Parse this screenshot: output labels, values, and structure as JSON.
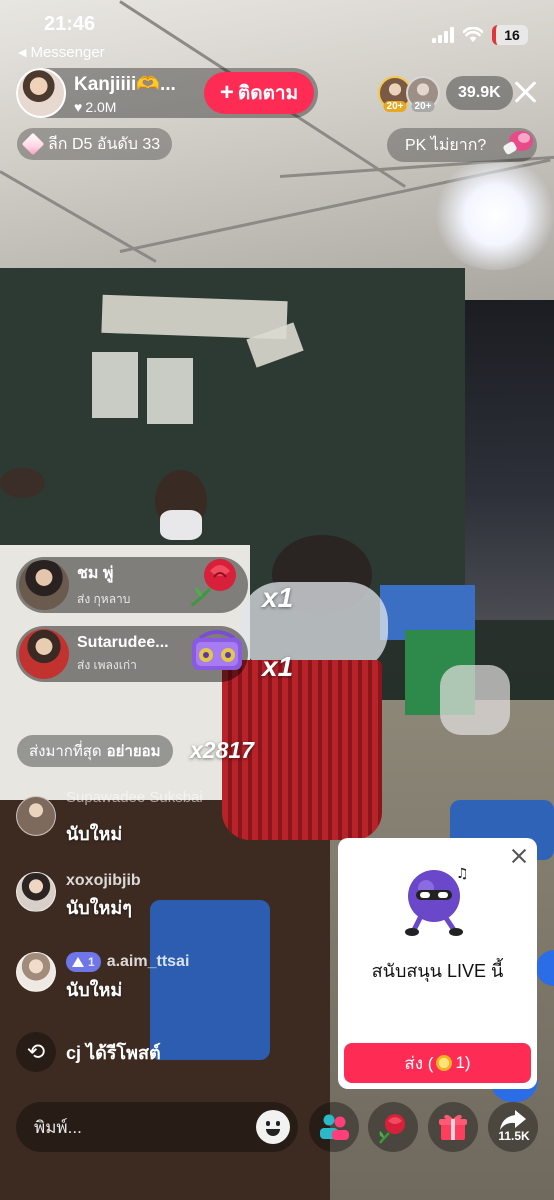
{
  "status_bar": {
    "time": "21:46",
    "battery": "16"
  },
  "back_nav": {
    "label": "Messenger"
  },
  "host": {
    "name": "Kanjiiii🫶...",
    "likes": "2.0M",
    "follow_label": "ติดตาม"
  },
  "viewers": {
    "ranks": [
      "20+",
      "20+"
    ],
    "count": "39.9K"
  },
  "league": {
    "label": "ลีก D5 อันดับ 33"
  },
  "pk": {
    "label": "PK ไม่ยาก?"
  },
  "gifts": [
    {
      "user": "ชม พู่",
      "desc": "ส่ง กุหลาบ",
      "combo": "x1",
      "icon": "rose-icon"
    },
    {
      "user": "Sutarudee...",
      "desc": "ส่ง เพลงเก่า",
      "combo": "x1",
      "icon": "boombox-icon"
    }
  ],
  "top_gifter": {
    "label": "ส่งมากที่สุด",
    "name": "อย่ายอม",
    "combo": "x2817"
  },
  "faded_username": "Supawadee Suksbai",
  "chat": [
    {
      "name": "",
      "message": "นับใหม่"
    },
    {
      "name": "xoxojibjib",
      "message": "นับใหม่ๆ"
    },
    {
      "name": "a.aim_ttsai",
      "level": "1",
      "message": "นับใหม่"
    }
  ],
  "repost": {
    "text": "cj ได้รีโพสต์"
  },
  "support_card": {
    "title": "สนับสนุน LIVE นี้",
    "send_label": "ส่ง (",
    "send_suffix": "1)"
  },
  "bottom_bar": {
    "placeholder": "พิมพ์...",
    "share_count": "11.5K"
  },
  "colors": {
    "accent": "#fe2c55",
    "level_badge": "#6f77e8",
    "coin": "#f0b21e"
  }
}
